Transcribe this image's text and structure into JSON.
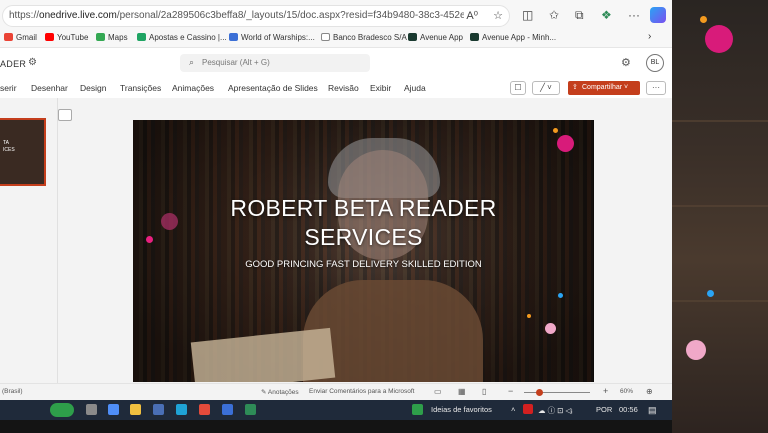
{
  "browser": {
    "url_prefix": "https://",
    "url_domain": "onedrive.live.com",
    "url_rest": "/personal/2a289506c3beffa8/_layouts/15/doc.aspx?resid=f34b9480-38c3-452e-a168-80291...",
    "read_aloud": "A⁰",
    "favorites": [
      {
        "label": "Gmail",
        "color": "#ea4335"
      },
      {
        "label": "YouTube",
        "color": "#ff0000"
      },
      {
        "label": "Maps",
        "color": "#34a853"
      },
      {
        "label": "Apostas e Cassino |...",
        "color": "#1fa463"
      },
      {
        "label": "World of Warships:...",
        "color": "#3b6fd6"
      },
      {
        "label": "Banco Bradesco S/A",
        "color": "#888888"
      },
      {
        "label": "Avenue App",
        "color": "#1a3a30"
      },
      {
        "label": "Avenue App - Minh...",
        "color": "#1a3a30"
      }
    ],
    "favorites_more": "›"
  },
  "app": {
    "doc_title": "ADER",
    "search_placeholder": "Pesquisar (Alt + G)",
    "avatar_initials": "BL",
    "tabs": [
      "serir",
      "Desenhar",
      "Design",
      "Transições",
      "Animações",
      "Apresentação de Slides",
      "Revisão",
      "Exibir",
      "Ajuda"
    ],
    "share_label": "Compartilhar",
    "pen_label": "╱ ˅",
    "more_label": "···",
    "comment_label": "☐"
  },
  "thumbnail": {
    "line1": "TA",
    "line2": "ICES"
  },
  "slide": {
    "title_line1": "ROBERT BETA READER",
    "title_line2": "SERVICES",
    "subtitle": "GOOD PRINCING FAST DELIVERY SKILLED EDITION"
  },
  "status": {
    "language": "(Brasil)",
    "notes": "Anotações",
    "feedback": "Enviar Comentários para a Microsoft",
    "zoom_minus": "−",
    "zoom_plus": "+",
    "zoom_level": "60%"
  },
  "taskbar": {
    "favorites_label": "Ideias de favoritos",
    "language": "POR",
    "time": "00:56"
  },
  "colors": {
    "accent": "#c43e1c",
    "decor_pink": "#d81b7a",
    "decor_orange": "#f39a1f",
    "decor_blue": "#2aa4f4",
    "decor_light_pink": "#f0a8c8"
  }
}
